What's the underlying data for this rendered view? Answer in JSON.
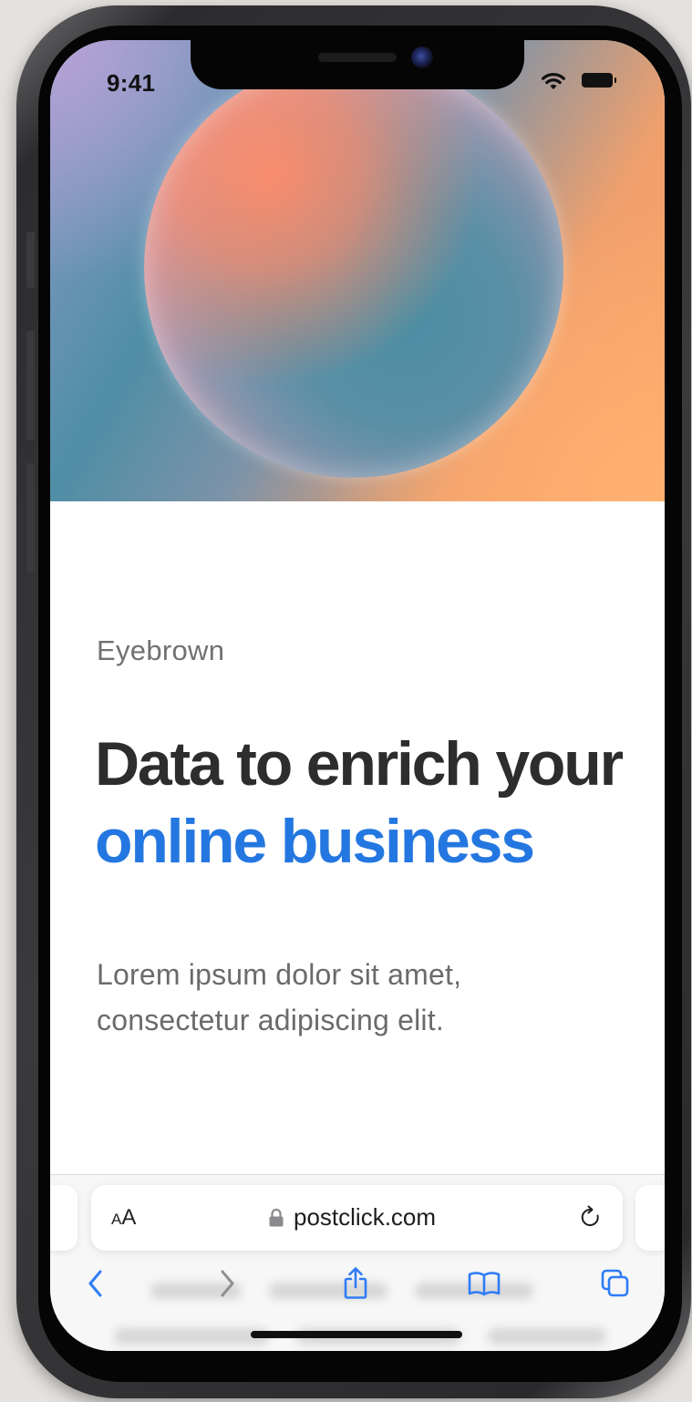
{
  "status_bar": {
    "time": "9:41",
    "icons": [
      "wifi-icon",
      "battery-icon"
    ]
  },
  "hero": {
    "image": "gradient-sphere",
    "colors": [
      "#b6a2d6",
      "#4f8ea6",
      "#ffa66a"
    ]
  },
  "content": {
    "eyebrow": "Eyebrown",
    "headline_part1": "Data to enrich your ",
    "headline_accent": "online business",
    "body": "Lorem ipsum dolor sit amet, consectetur adipiscing elit."
  },
  "browser": {
    "text_size_label_small": "A",
    "text_size_label_large": "A",
    "url": "postclick.com",
    "icons": [
      "lock-icon",
      "reload-icon"
    ]
  },
  "toolbar": {
    "buttons": [
      "back-icon",
      "forward-icon",
      "share-icon",
      "bookmarks-icon",
      "tabs-icon"
    ]
  },
  "colors": {
    "accent": "#2477e0",
    "headline": "#2d2d2d",
    "body": "#6b6b6b",
    "eyebrow": "#717171",
    "safari_blue": "#2f7cf6"
  }
}
